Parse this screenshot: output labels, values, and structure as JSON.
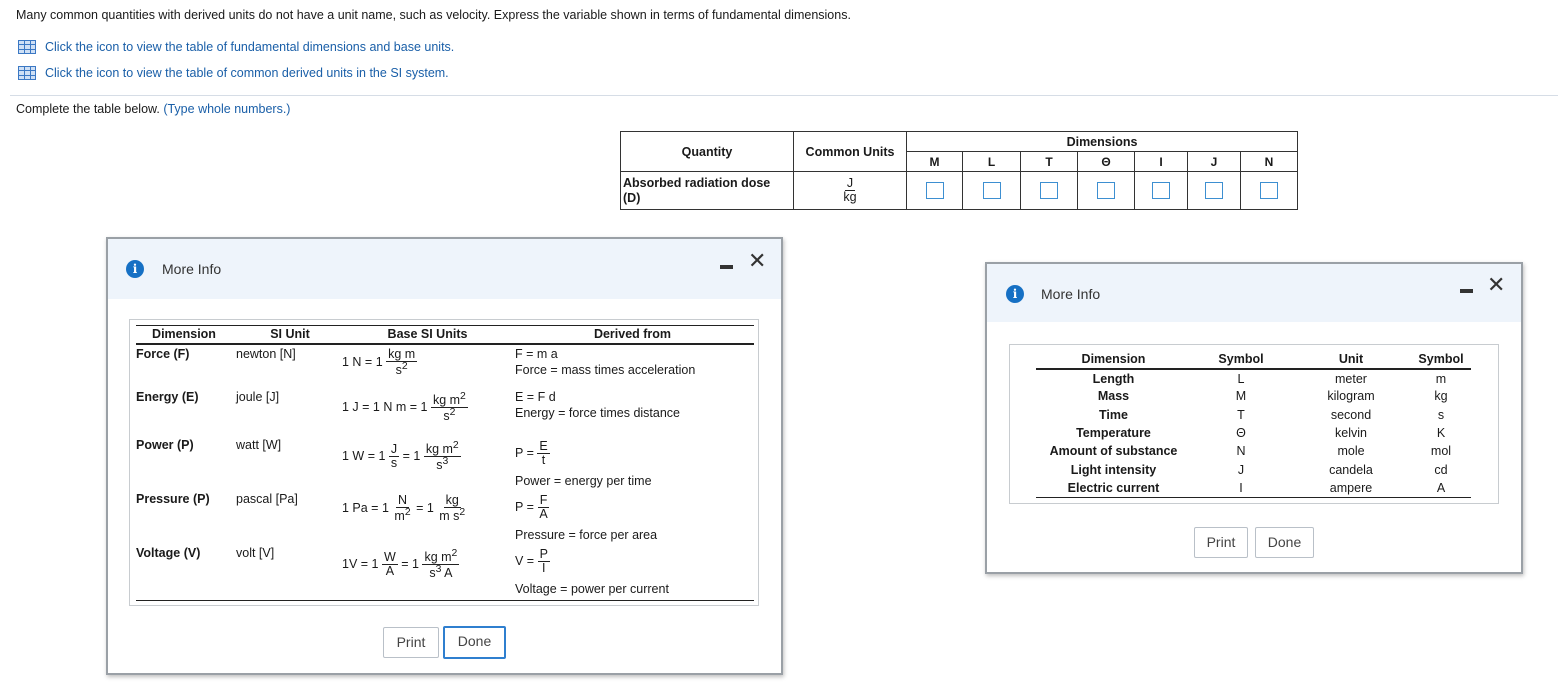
{
  "prompt": "Many common quantities with derived units do not have a unit name, such as velocity. Express the variable shown in terms of fundamental dimensions.",
  "links": [
    {
      "label": "Click the icon to view the table of fundamental dimensions and base units.",
      "icon": "table-icon"
    },
    {
      "label": "Click the icon to view the table of common derived units in the SI system.",
      "icon": "table-icon"
    }
  ],
  "instruction": "Complete the table below.",
  "instruction_hint": "(Type whole numbers.)",
  "answer_table": {
    "header_quantity": "Quantity",
    "header_units": "Common Units",
    "header_dimensions": "Dimensions",
    "dimension_symbols": [
      "M",
      "L",
      "T",
      "Θ",
      "I",
      "J",
      "N"
    ],
    "quantity_line1": "Absorbed radiation dose",
    "quantity_line2": "(D)",
    "unit_num": "J",
    "unit_den": "kg"
  },
  "dialog_derived": {
    "title": "More Info",
    "headers": {
      "dimension": "Dimension",
      "si_unit": "SI Unit",
      "base": "Base SI Units",
      "derived": "Derived from"
    },
    "rows": [
      {
        "dimension": "Force (F)",
        "si_unit": "newton [N]",
        "eq": "F = m a",
        "desc": "Force = mass times acceleration"
      },
      {
        "dimension": "Energy (E)",
        "si_unit": "joule [J]",
        "eq": "E = F d",
        "desc": "Energy = force times distance"
      },
      {
        "dimension": "Power (P)",
        "si_unit": "watt [W]",
        "desc": "Power = energy per time"
      },
      {
        "dimension": "Pressure (P)",
        "si_unit": "pascal [Pa]",
        "desc": "Pressure = force per area"
      },
      {
        "dimension": "Voltage (V)",
        "si_unit": "volt [V]",
        "desc": "Voltage = power per current"
      }
    ],
    "print_label": "Print",
    "done_label": "Done"
  },
  "dialog_fundamental": {
    "title": "More Info",
    "headers": {
      "dimension": "Dimension",
      "symbol": "Symbol",
      "unit": "Unit",
      "unit_symbol": "Symbol"
    },
    "rows": [
      {
        "dimension": "Length",
        "symbol": "L",
        "unit": "meter",
        "unit_symbol": "m"
      },
      {
        "dimension": "Mass",
        "symbol": "M",
        "unit": "kilogram",
        "unit_symbol": "kg"
      },
      {
        "dimension": "Time",
        "symbol": "T",
        "unit": "second",
        "unit_symbol": "s"
      },
      {
        "dimension": "Temperature",
        "symbol": "Θ",
        "unit": "kelvin",
        "unit_symbol": "K"
      },
      {
        "dimension": "Amount of substance",
        "symbol": "N",
        "unit": "mole",
        "unit_symbol": "mol"
      },
      {
        "dimension": "Light intensity",
        "symbol": "J",
        "unit": "candela",
        "unit_symbol": "cd"
      },
      {
        "dimension": "Electric current",
        "symbol": "I",
        "unit": "ampere",
        "unit_symbol": "A"
      }
    ],
    "print_label": "Print",
    "done_label": "Done"
  },
  "colors": {
    "link": "#1a5fa8",
    "info_icon": "#1670c4",
    "input_border": "#3d8fd1",
    "dialog_header": "#eef4fb"
  }
}
